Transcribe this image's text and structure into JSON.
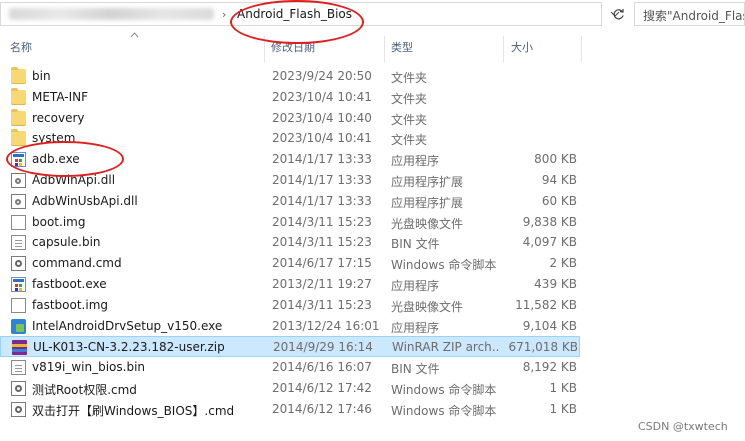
{
  "address_bar": {
    "current_folder": "Android_Flash_Bios",
    "separator": "›"
  },
  "search": {
    "placeholder": "搜索\"Android_Flas"
  },
  "columns": {
    "name": "名称",
    "date": "修改日期",
    "type": "类型",
    "size": "大小"
  },
  "files": [
    {
      "name": "bin",
      "date": "2023/9/24 20:50",
      "type": "文件夹",
      "size": "",
      "icon": "folder-icon"
    },
    {
      "name": "META-INF",
      "date": "2023/10/4 10:41",
      "type": "文件夹",
      "size": "",
      "icon": "folder-icon"
    },
    {
      "name": "recovery",
      "date": "2023/10/4 10:40",
      "type": "文件夹",
      "size": "",
      "icon": "folder-icon"
    },
    {
      "name": "system",
      "date": "2023/10/4 10:41",
      "type": "文件夹",
      "size": "",
      "icon": "folder-icon"
    },
    {
      "name": "adb.exe",
      "date": "2014/1/17 13:33",
      "type": "应用程序",
      "size": "800 KB",
      "icon": "application-icon"
    },
    {
      "name": "AdbWinApi.dll",
      "date": "2014/1/17 13:33",
      "type": "应用程序扩展",
      "size": "94 KB",
      "icon": "dll-icon"
    },
    {
      "name": "AdbWinUsbApi.dll",
      "date": "2014/1/17 13:33",
      "type": "应用程序扩展",
      "size": "60 KB",
      "icon": "dll-icon"
    },
    {
      "name": "boot.img",
      "date": "2014/3/11 15:23",
      "type": "光盘映像文件",
      "size": "9,838 KB",
      "icon": "disc-image-icon"
    },
    {
      "name": "capsule.bin",
      "date": "2014/3/11 15:23",
      "type": "BIN 文件",
      "size": "4,097 KB",
      "icon": "document-icon"
    },
    {
      "name": "command.cmd",
      "date": "2014/6/17 17:15",
      "type": "Windows 命令脚本",
      "size": "2 KB",
      "icon": "cmd-script-icon"
    },
    {
      "name": "fastboot.exe",
      "date": "2013/2/11 19:27",
      "type": "应用程序",
      "size": "439 KB",
      "icon": "application-icon"
    },
    {
      "name": "fastboot.img",
      "date": "2014/3/11 15:23",
      "type": "光盘映像文件",
      "size": "11,582 KB",
      "icon": "disc-image-icon"
    },
    {
      "name": "IntelAndroidDrvSetup_v150.exe",
      "date": "2013/12/24 16:01",
      "type": "应用程序",
      "size": "9,104 KB",
      "icon": "installer-icon"
    },
    {
      "name": "UL-K013-CN-3.2.23.182-user.zip",
      "date": "2014/9/29 16:14",
      "type": "WinRAR ZIP arch...",
      "size": "671,018 KB",
      "icon": "winrar-archive-icon",
      "selected": true
    },
    {
      "name": "v819i_win_bios.bin",
      "date": "2014/6/16 16:07",
      "type": "BIN 文件",
      "size": "8,192 KB",
      "icon": "document-icon"
    },
    {
      "name": "测试Root权限.cmd",
      "date": "2014/6/12 17:42",
      "type": "Windows 命令脚本",
      "size": "1 KB",
      "icon": "cmd-script-icon"
    },
    {
      "name": "双击打开【刷Windows_BIOS】.cmd",
      "date": "2014/6/12 17:46",
      "type": "Windows 命令脚本",
      "size": "1 KB",
      "icon": "cmd-script-icon"
    }
  ],
  "watermark": "CSDN @txwtech"
}
